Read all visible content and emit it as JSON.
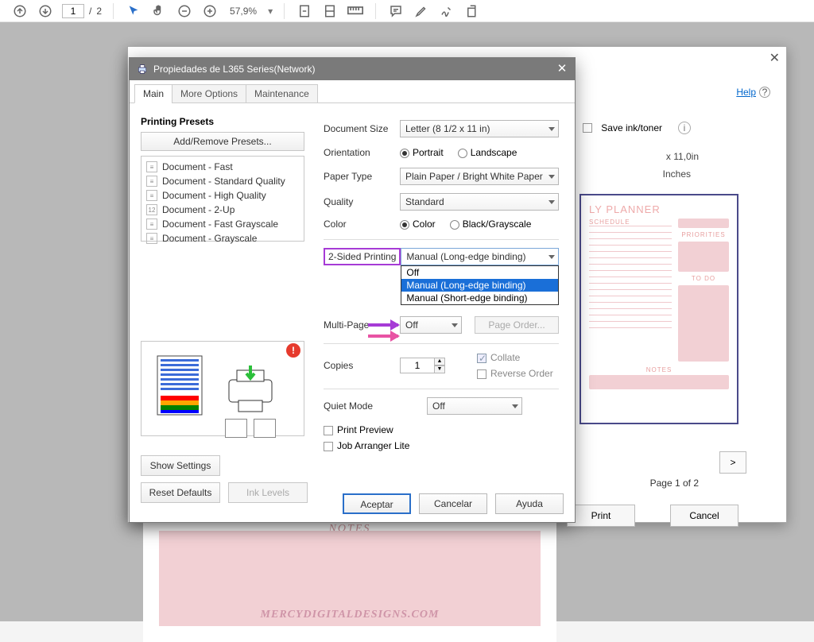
{
  "toolbar": {
    "page_current": "1",
    "page_sep": "/",
    "page_total": "2",
    "zoom": "57,9%"
  },
  "print_underlay": {
    "help": "Help",
    "save_ink": "Save ink/toner",
    "dims": "x 11,0in",
    "units": "Inches",
    "page_indicator": "Page 1 of 2",
    "next": ">",
    "print": "Print",
    "cancel": "Cancel",
    "planner_title": "LY PLANNER",
    "planner_schedule": "SCHEDULE",
    "planner_priorities": "PRIORITIES",
    "planner_todo": "TO DO",
    "planner_notes": "NOTES"
  },
  "doc": {
    "notes": "NOTES",
    "watermark": "MERCYDIGITALDESIGNS.COM"
  },
  "props": {
    "title": "Propiedades de L365 Series(Network)",
    "tabs": {
      "main": "Main",
      "more": "More Options",
      "maint": "Maintenance"
    },
    "presets_title": "Printing Presets",
    "add_remove": "Add/Remove Presets...",
    "presets": [
      "Document - Fast",
      "Document - Standard Quality",
      "Document - High Quality",
      "Document - 2-Up",
      "Document - Fast Grayscale",
      "Document - Grayscale"
    ],
    "labels": {
      "doc_size": "Document Size",
      "orientation": "Orientation",
      "paper_type": "Paper Type",
      "quality": "Quality",
      "color": "Color",
      "twosided": "2-Sided Printing",
      "multipage": "Multi-Page",
      "copies": "Copies",
      "quiet": "Quiet Mode",
      "page_order": "Page Order...",
      "collate": "Collate",
      "reverse": "Reverse Order",
      "print_preview": "Print Preview",
      "job_arranger": "Job Arranger Lite"
    },
    "values": {
      "doc_size": "Letter (8 1/2 x 11 in)",
      "portrait": "Portrait",
      "landscape": "Landscape",
      "paper_type": "Plain Paper / Bright White Paper",
      "quality": "Standard",
      "color": "Color",
      "bw": "Black/Grayscale",
      "twosided_sel": "Manual (Long-edge binding)",
      "twosided_opts": [
        "Off",
        "Manual (Long-edge binding)",
        "Manual (Short-edge binding)"
      ],
      "multipage": "Off",
      "copies": "1",
      "quiet": "Off"
    },
    "buttons": {
      "show_settings": "Show Settings",
      "reset": "Reset Defaults",
      "ink": "Ink Levels",
      "ok": "Aceptar",
      "cancel": "Cancelar",
      "help": "Ayuda"
    }
  }
}
